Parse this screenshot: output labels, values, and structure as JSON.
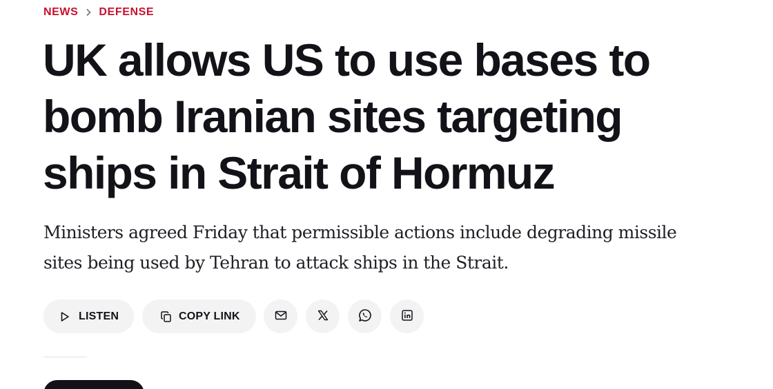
{
  "breadcrumb": {
    "items": [
      "NEWS",
      "DEFENSE"
    ],
    "separator": "›"
  },
  "article": {
    "headline": "UK allows US to use bases to bomb Iranian sites targeting ships in Strait of Hormuz",
    "dek": "Ministers agreed Friday that permissible actions include degrading missile sites being used by Tehran to attack ships in the Strait."
  },
  "share_bar": {
    "listen_label": "LISTEN",
    "copy_link_label": "COPY LINK",
    "icons": [
      "play-icon",
      "copy-icon",
      "mail-icon",
      "x-logo-icon",
      "whatsapp-icon",
      "linkedin-icon"
    ]
  },
  "colors": {
    "accent": "#c8102e",
    "text": "#121218",
    "pill_background": "#f3f3f4"
  }
}
